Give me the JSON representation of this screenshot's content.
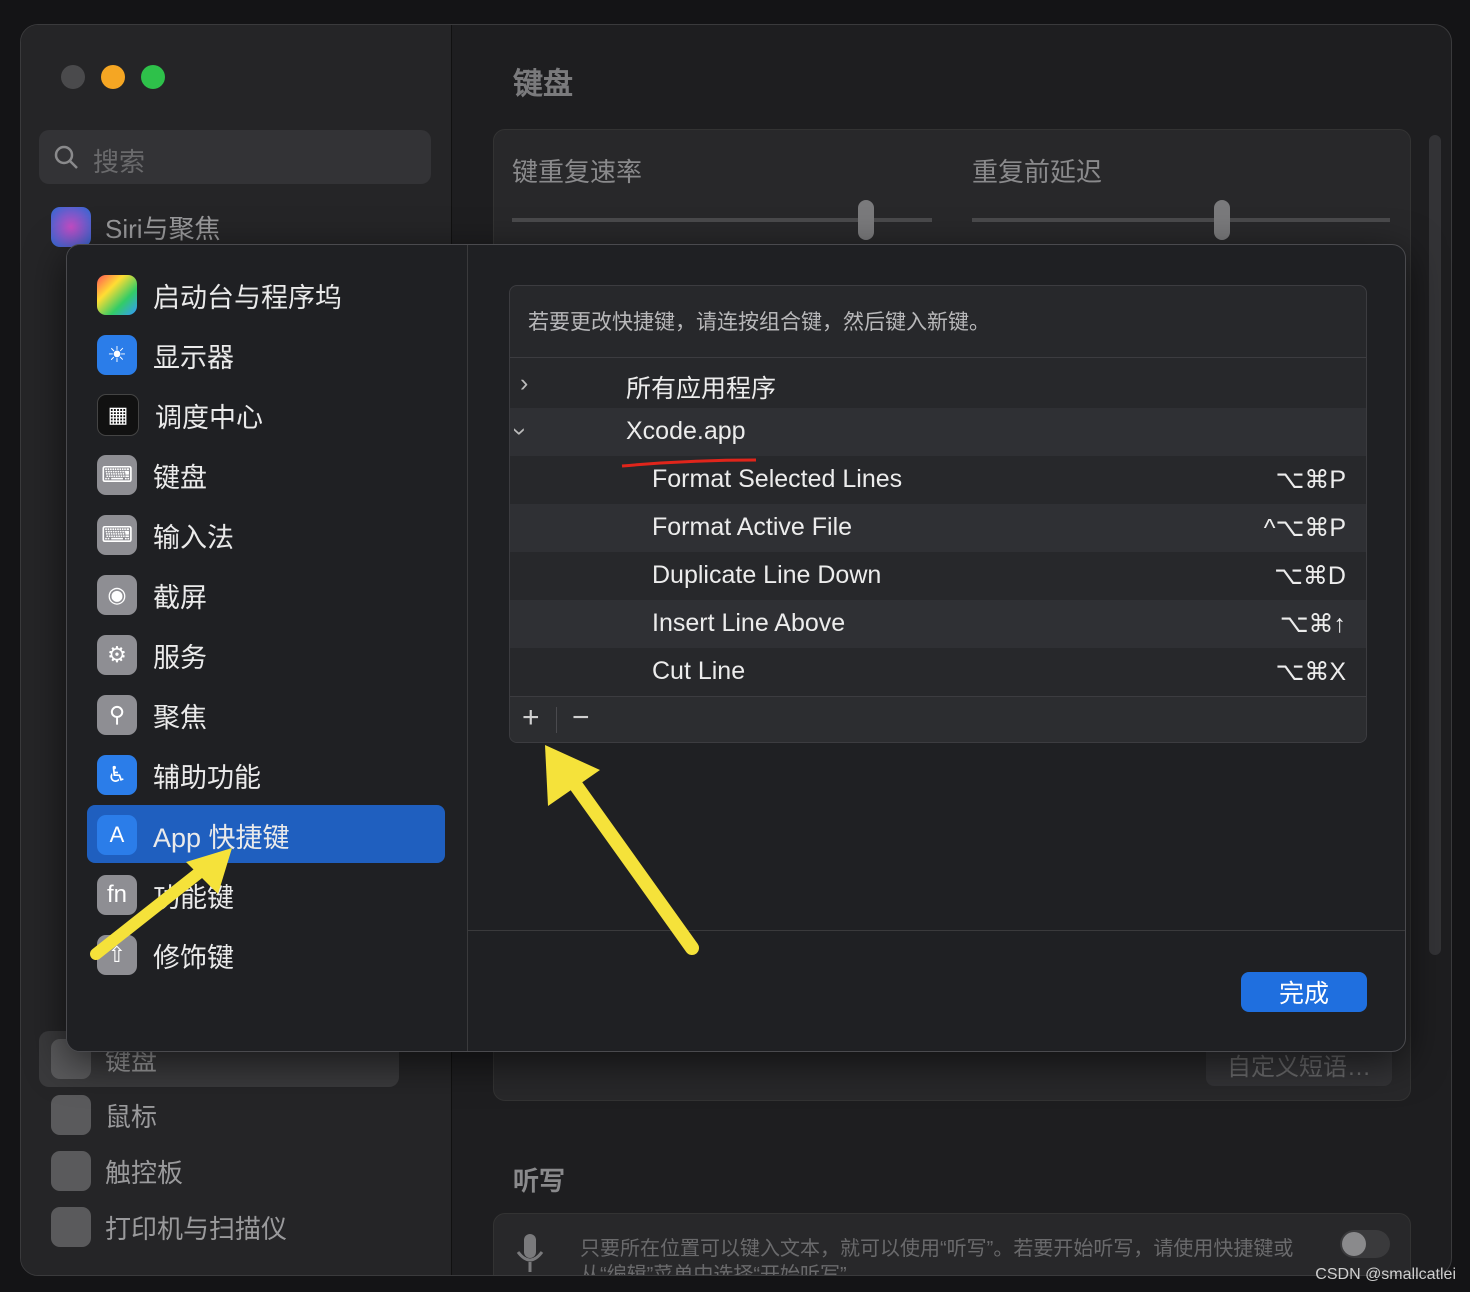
{
  "window_title": "键盘",
  "search_placeholder": "搜索",
  "bg_sidebar": [
    "Siri与聚焦",
    "键盘",
    "鼠标",
    "触控板",
    "打印机与扫描仪"
  ],
  "keyboard_section": {
    "repeat_rate": "键重复速率",
    "delay": "重复前延迟",
    "custom_phrases": "自定义短语…"
  },
  "dictation": {
    "title": "听写",
    "desc": "只要所在位置可以键入文本，就可以使用“听写”。若要开始听写，请使用快捷键或",
    "desc2": "从“编辑”菜单中选择“开始听写”。"
  },
  "modal": {
    "sidebar": [
      {
        "label": "启动台与程序坞"
      },
      {
        "label": "显示器"
      },
      {
        "label": "调度中心"
      },
      {
        "label": "键盘"
      },
      {
        "label": "输入法"
      },
      {
        "label": "截屏"
      },
      {
        "label": "服务"
      },
      {
        "label": "聚焦"
      },
      {
        "label": "辅助功能"
      },
      {
        "label": "App 快捷键"
      },
      {
        "label": "功能键"
      },
      {
        "label": "修饰键"
      }
    ],
    "selected": "App 快捷键",
    "fn_glyph": "fn",
    "hint": "若要更改快捷键，请连按组合键，然后键入新键。",
    "groups": [
      {
        "label": "所有应用程序"
      },
      {
        "label": "Xcode.app"
      }
    ],
    "shortcuts": [
      {
        "name": "Format Selected Lines",
        "keys": "⌥⌘P"
      },
      {
        "name": "Format Active File",
        "keys": "^⌥⌘P"
      },
      {
        "name": "Duplicate Line Down",
        "keys": "⌥⌘D"
      },
      {
        "name": "Insert Line Above",
        "keys": "⌥⌘↑"
      },
      {
        "name": "Cut Line",
        "keys": "⌥⌘X"
      }
    ],
    "add": "+",
    "remove": "−",
    "done": "完成"
  },
  "watermark": "CSDN @smallcatlei",
  "colors": {
    "accent": "#1f6fdf",
    "selection": "#1f5fbf",
    "arrow": "#f5e23a",
    "underline": "#e0251b"
  }
}
